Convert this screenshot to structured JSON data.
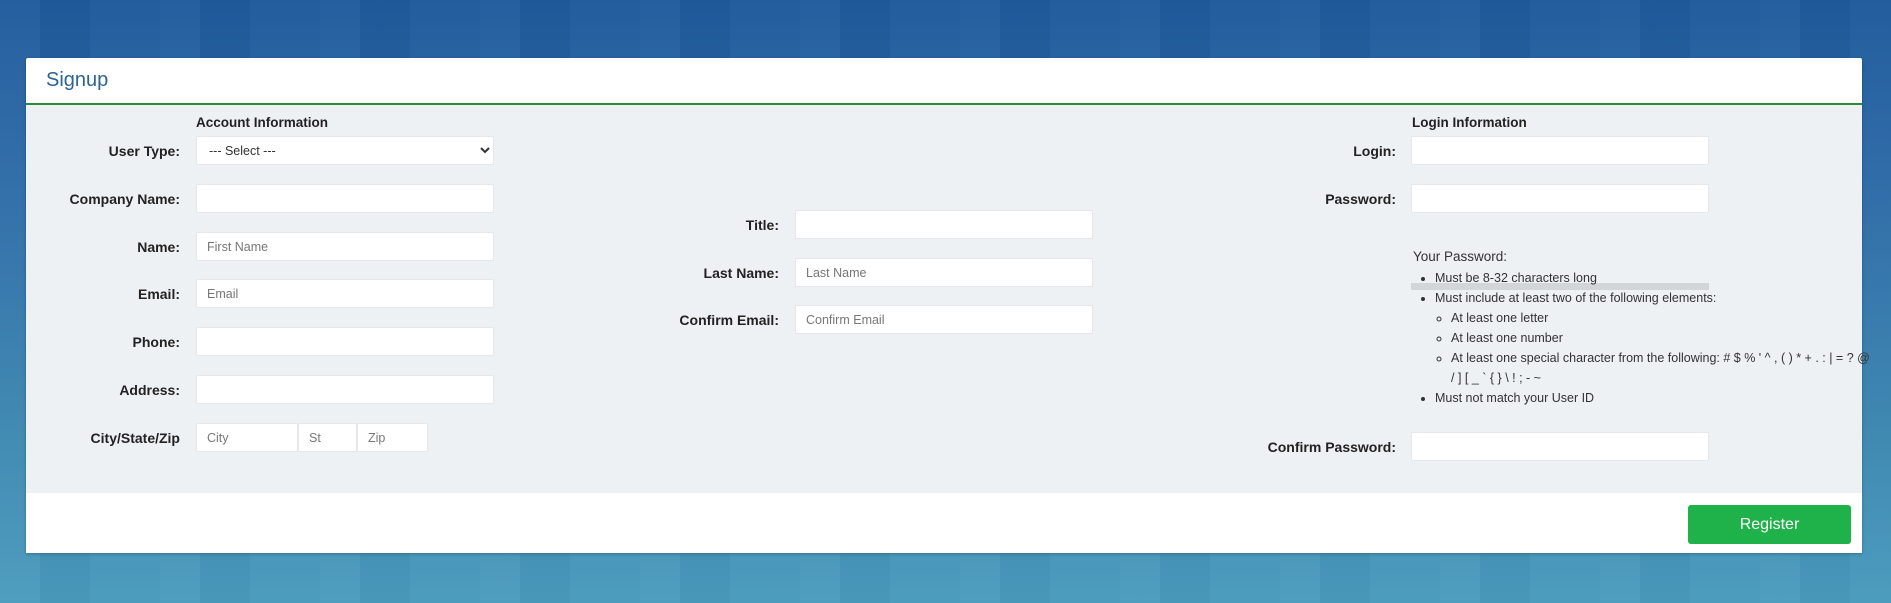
{
  "header": {
    "title": "Signup"
  },
  "account": {
    "section_title": "Account Information",
    "user_type": {
      "label": "User Type:",
      "selected": "--- Select ---"
    },
    "company_name": {
      "label": "Company Name:",
      "value": "",
      "placeholder": ""
    },
    "name": {
      "label": "Name:",
      "placeholder": "First Name"
    },
    "email": {
      "label": "Email:",
      "placeholder": "Email"
    },
    "phone": {
      "label": "Phone:",
      "placeholder": ""
    },
    "address": {
      "label": "Address:",
      "placeholder": ""
    },
    "city_state_zip": {
      "label": "City/State/Zip",
      "city_placeholder": "City",
      "state_placeholder": "St",
      "zip_placeholder": "Zip"
    },
    "title": {
      "label": "Title:",
      "placeholder": ""
    },
    "last_name": {
      "label": "Last Name:",
      "placeholder": "Last Name"
    },
    "confirm_email": {
      "label": "Confirm Email:",
      "placeholder": "Confirm Email"
    }
  },
  "login": {
    "section_title": "Login Information",
    "login_field": {
      "label": "Login:",
      "placeholder": ""
    },
    "password_field": {
      "label": "Password:",
      "placeholder": ""
    },
    "confirm_password": {
      "label": "Confirm Password:",
      "placeholder": ""
    },
    "rules": {
      "title": "Your Password:",
      "length": "Must be 8-32 characters long",
      "elements": "Must include at least two of the following elements:",
      "letter": "At least one letter",
      "number": "At least one number",
      "special": "At least one special character from the following: # $ % ' ^ , ( ) * + . : | = ? @ / ] [ _ ` { } \\ ! ; - ~",
      "no_match": "Must not match your User ID"
    }
  },
  "footer": {
    "register_label": "Register"
  },
  "colors": {
    "accent_green": "#1fb14a",
    "title_blue": "#2c6494",
    "header_rule": "#2e8b3e"
  }
}
